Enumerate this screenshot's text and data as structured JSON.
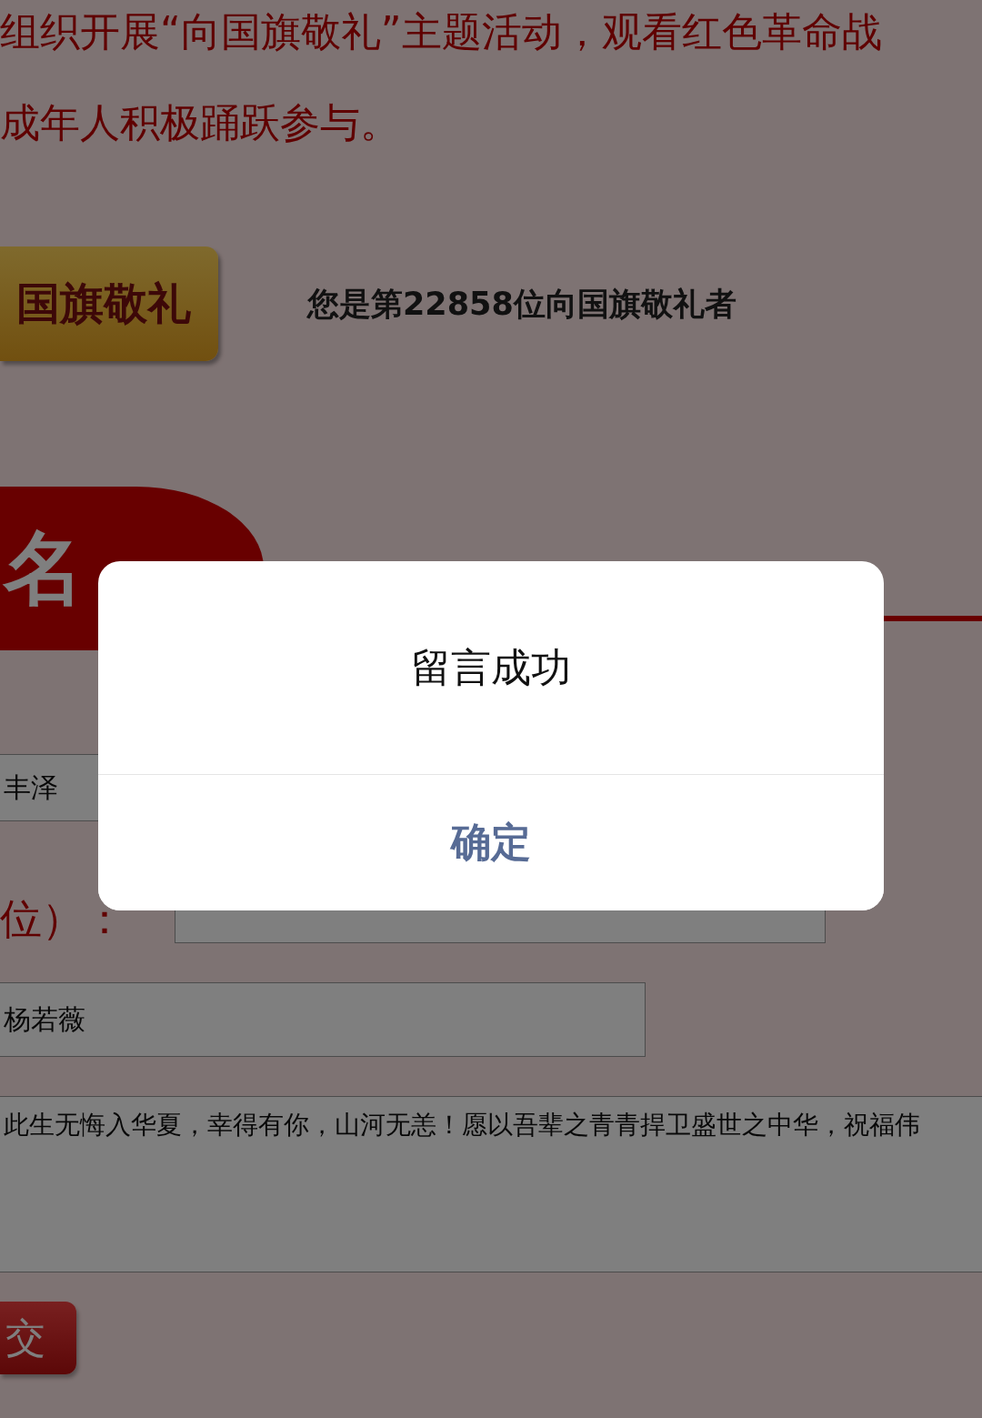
{
  "intro": {
    "lines": [
      "组织开展“向国旗敬礼”主题活动，观看红色革命战",
      "成年人积极踊跃参与。"
    ]
  },
  "salute": {
    "button": "国旗敬礼",
    "counter": "您是第22858位向国旗敬礼者"
  },
  "guestbook": {
    "title": "名",
    "fields": [
      {
        "kind": "input",
        "value": "丰泽"
      },
      {
        "kind": "labeled-input",
        "label": "位）："
      },
      {
        "kind": "input",
        "value": "杨若薇"
      },
      {
        "kind": "textarea",
        "value": "此生无悔入华夏，幸得有你，山河无恙！愿以吾辈之青青捍卫盛世之中华，祝福伟"
      }
    ],
    "submit": "交"
  },
  "dialog": {
    "message": "留言成功",
    "confirm": "确定"
  }
}
